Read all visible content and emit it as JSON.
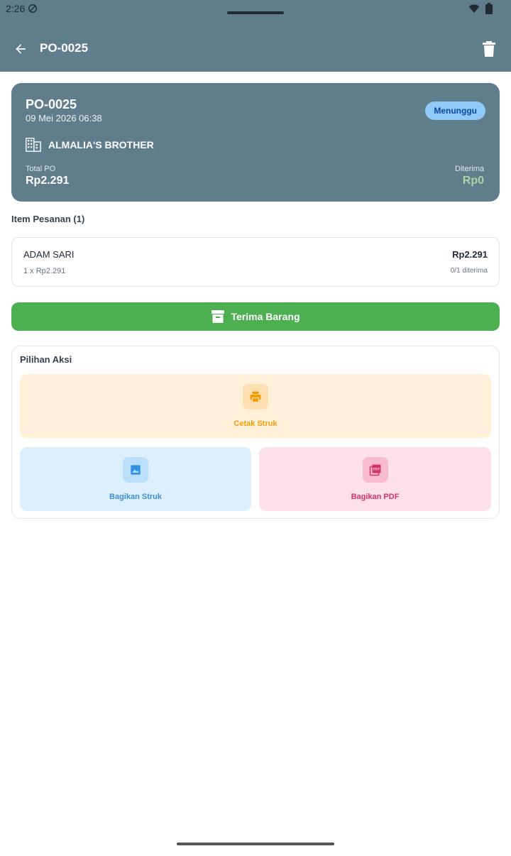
{
  "status_bar": {
    "time": "2:26"
  },
  "appbar": {
    "title": "PO-0025"
  },
  "header": {
    "po_number": "PO-0025",
    "date": "09 Mei 2026 06:38",
    "status": "Menunggu",
    "supplier": "ALMALIA'S BROTHER",
    "total_label": "Total PO",
    "total_value": "Rp2.291",
    "received_label": "Diterima",
    "received_value": "Rp0"
  },
  "items_section": {
    "title": "Item Pesanan (1)",
    "items": [
      {
        "name": "ADAM SARI",
        "qty_price": "1 x Rp2.291",
        "total": "Rp2.291",
        "received": "0/1 diterima"
      }
    ]
  },
  "receive_button": {
    "label": "Terima Barang"
  },
  "actions": {
    "title": "Pilihan Aksi",
    "print_label": "Cetak Struk",
    "share_label": "Bagikan Struk",
    "pdf_label": "Bagikan PDF"
  },
  "colors": {
    "primary": "#607d8b",
    "success": "#4caf50",
    "badge_bg": "#90caf9",
    "received": "#a5d6a7"
  },
  "icons": {
    "back": "arrow-left-icon",
    "delete": "trash-icon",
    "supplier": "building-icon",
    "receive": "archive-box-icon",
    "print": "printer-icon",
    "share": "image-icon",
    "pdf": "pdf-file-icon"
  }
}
